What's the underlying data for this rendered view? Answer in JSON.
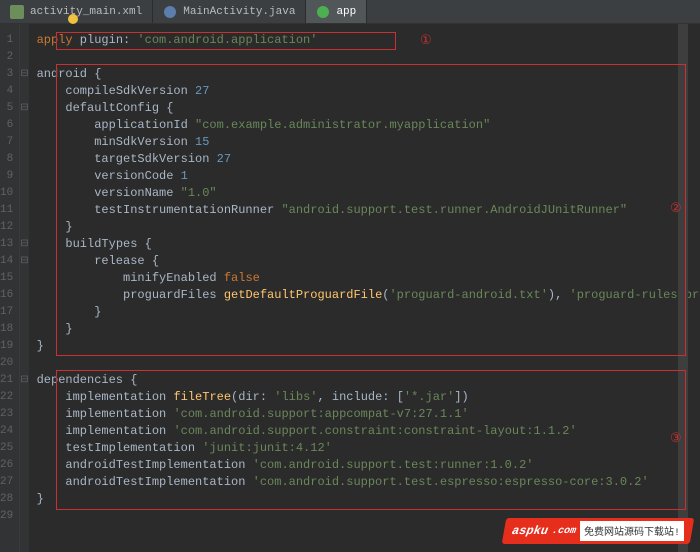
{
  "tabs": [
    {
      "label": "activity_main.xml",
      "icon": "xml",
      "active": false
    },
    {
      "label": "MainActivity.java",
      "icon": "java",
      "active": false
    },
    {
      "label": "app",
      "icon": "gradle",
      "active": true
    }
  ],
  "annotations": {
    "a1": "①",
    "a2": "②",
    "a3": "③"
  },
  "watermark": {
    "brand": "aspku",
    "suffix": ".com",
    "sub": "免费网站源码下载站!"
  },
  "code": {
    "l1": {
      "kw1": "apply",
      "id1": " plugin: ",
      "str1": "'com.android.application'"
    },
    "l3": {
      "id1": "android {"
    },
    "l4": {
      "id1": "compileSdkVersion ",
      "num1": "27"
    },
    "l5": {
      "id1": "defaultConfig {"
    },
    "l6": {
      "id1": "applicationId ",
      "str1": "\"com.example.administrator.myapplication\""
    },
    "l7": {
      "id1": "minSdkVersion ",
      "num1": "15"
    },
    "l8": {
      "id1": "targetSdkVersion ",
      "num1": "27"
    },
    "l9": {
      "id1": "versionCode ",
      "num1": "1"
    },
    "l10": {
      "id1": "versionName ",
      "str1": "\"1.0\""
    },
    "l11": {
      "id1": "testInstrumentationRunner ",
      "str1": "\"android.support.test.runner.AndroidJUnitRunner\""
    },
    "l12": {
      "id1": "}"
    },
    "l13": {
      "id1": "buildTypes {"
    },
    "l14": {
      "id1": "release {"
    },
    "l15": {
      "id1": "minifyEnabled ",
      "kw1": "false"
    },
    "l16": {
      "id1": "proguardFiles ",
      "fn1": "getDefaultProguardFile",
      "id2": "(",
      "str1": "'proguard-android.txt'",
      "id3": "), ",
      "str2": "'proguard-rules.pro'"
    },
    "l17": {
      "id1": "}"
    },
    "l18": {
      "id1": "}"
    },
    "l19": {
      "id1": "}"
    },
    "l21": {
      "id1": "dependencies {"
    },
    "l22": {
      "id1": "implementation ",
      "fn1": "fileTree",
      "id2": "(dir: ",
      "str1": "'libs'",
      "id3": ", include: [",
      "str2": "'*.jar'",
      "id4": "])"
    },
    "l23": {
      "id1": "implementation ",
      "str1": "'com.android.support:appcompat-v7:27.1.1'"
    },
    "l24": {
      "id1": "implementation ",
      "str1": "'com.android.support.constraint:constraint-layout:1.1.2'"
    },
    "l25": {
      "id1": "testImplementation ",
      "str1": "'junit:junit:4.12'"
    },
    "l26": {
      "id1": "androidTestImplementation ",
      "str1": "'com.android.support.test:runner:1.0.2'"
    },
    "l27": {
      "id1": "androidTestImplementation ",
      "str1": "'com.android.support.test.espresso:espresso-core:3.0.2'"
    },
    "l28": {
      "id1": "}"
    }
  }
}
